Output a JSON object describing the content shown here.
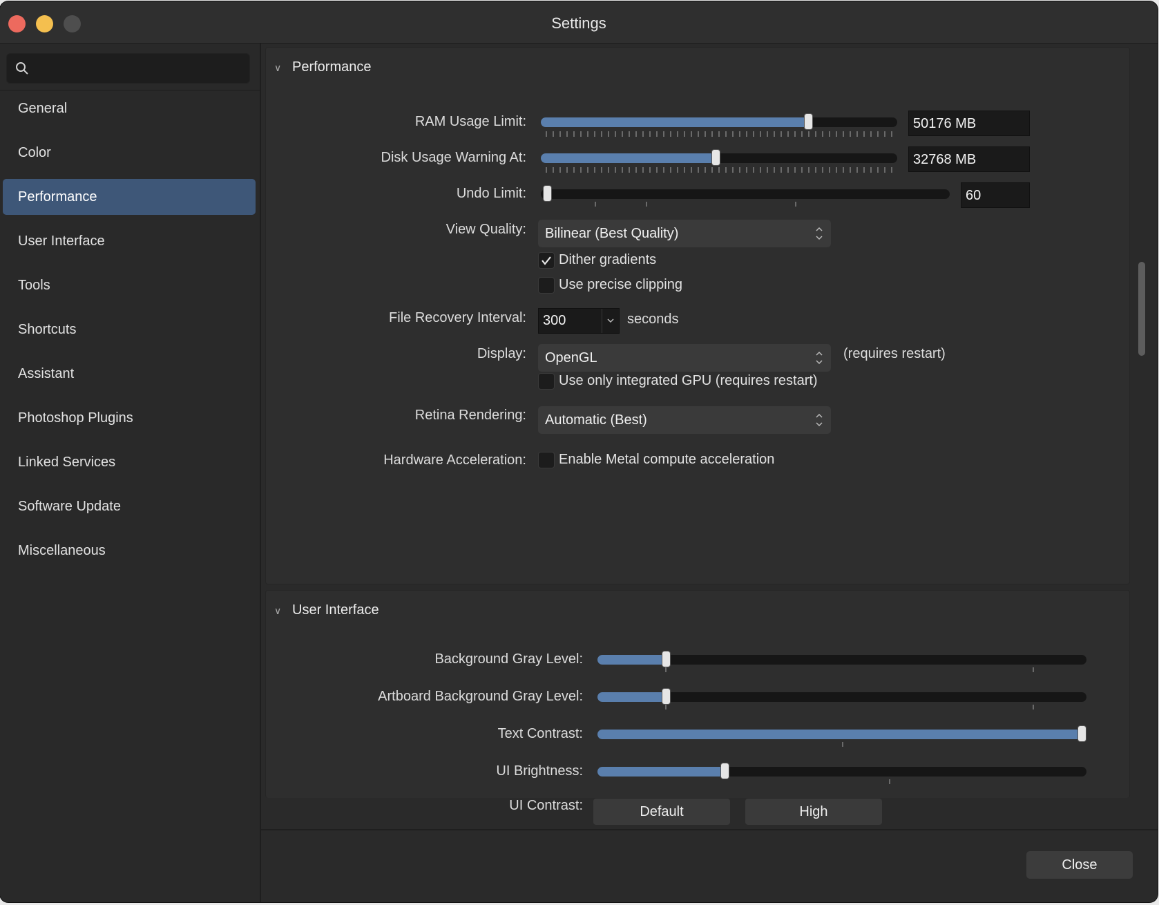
{
  "window": {
    "title": "Settings"
  },
  "search": {
    "placeholder": ""
  },
  "sidebar": {
    "items": [
      {
        "label": "General"
      },
      {
        "label": "Color"
      },
      {
        "label": "Performance"
      },
      {
        "label": "User Interface"
      },
      {
        "label": "Tools"
      },
      {
        "label": "Shortcuts"
      },
      {
        "label": "Assistant"
      },
      {
        "label": "Photoshop Plugins"
      },
      {
        "label": "Linked Services"
      },
      {
        "label": "Software Update"
      },
      {
        "label": "Miscellaneous"
      }
    ],
    "active_index": 2
  },
  "performance": {
    "title": "Performance",
    "ram": {
      "label": "RAM Usage Limit:",
      "value": "50176 MB",
      "level": 0.75
    },
    "disk": {
      "label": "Disk Usage Warning At:",
      "value": "32768 MB",
      "level": 0.49
    },
    "undo": {
      "label": "Undo Limit:",
      "value": "60",
      "level": 0.0
    },
    "view_quality": {
      "label": "View Quality:",
      "value": "Bilinear (Best Quality)"
    },
    "dither": {
      "label": "Dither gradients",
      "checked": true
    },
    "precise": {
      "label": "Use precise clipping",
      "checked": false
    },
    "recovery": {
      "label": "File Recovery Interval:",
      "value": "300",
      "unit": "seconds"
    },
    "display": {
      "label": "Display:",
      "value": "OpenGL",
      "note": "(requires restart)"
    },
    "integrated_gpu": {
      "label": "Use only integrated GPU (requires restart)",
      "checked": false
    },
    "retina": {
      "label": "Retina Rendering:",
      "value": "Automatic (Best)"
    },
    "hw_accel": {
      "label": "Hardware Acceleration:",
      "checkbox_label": "Enable Metal compute acceleration",
      "checked": false
    }
  },
  "user_interface": {
    "title": "User Interface",
    "bg_gray": {
      "label": "Background Gray Level:",
      "level": 0.14
    },
    "artboard_gray": {
      "label": "Artboard Background Gray Level:",
      "level": 0.14
    },
    "text_contrast": {
      "label": "Text Contrast:",
      "level": 0.99
    },
    "ui_brightness": {
      "label": "UI Brightness:",
      "level": 0.26
    },
    "ui_contrast": {
      "label": "UI Contrast:",
      "options": [
        "Default",
        "High"
      ]
    }
  },
  "footer": {
    "close_label": "Close"
  },
  "colors": {
    "accent": "#5a7fad",
    "selection": "#3e5778"
  }
}
